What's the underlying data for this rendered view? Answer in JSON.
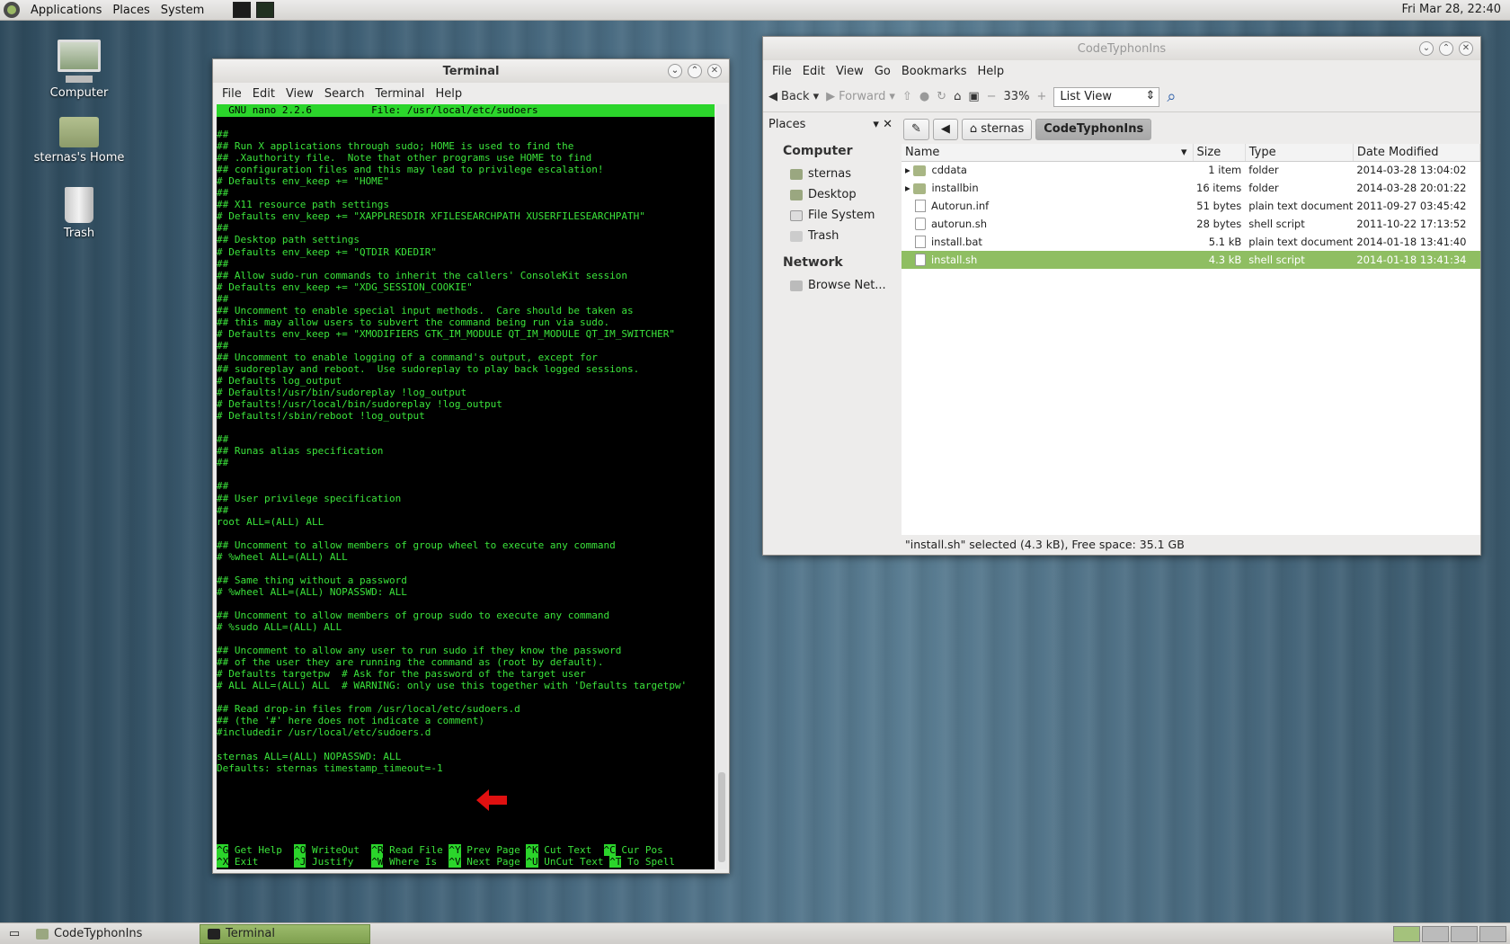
{
  "topbar": {
    "menus": [
      "Applications",
      "Places",
      "System"
    ],
    "clock": "Fri Mar 28, 22:40"
  },
  "desktop": {
    "icons": [
      {
        "label": "Computer",
        "icon": "computer-icon"
      },
      {
        "label": "sternas's Home",
        "icon": "home-folder-icon"
      },
      {
        "label": "Trash",
        "icon": "trash-icon"
      }
    ]
  },
  "terminal": {
    "title": "Terminal",
    "menus": [
      "File",
      "Edit",
      "View",
      "Search",
      "Terminal",
      "Help"
    ],
    "nano_header": "  GNU nano 2.2.6          File: /usr/local/etc/sudoers                           ",
    "lines": [
      "",
      "##",
      "## Run X applications through sudo; HOME is used to find the",
      "## .Xauthority file.  Note that other programs use HOME to find",
      "## configuration files and this may lead to privilege escalation!",
      "# Defaults env_keep += \"HOME\"",
      "##",
      "## X11 resource path settings",
      "# Defaults env_keep += \"XAPPLRESDIR XFILESEARCHPATH XUSERFILESEARCHPATH\"",
      "##",
      "## Desktop path settings",
      "# Defaults env_keep += \"QTDIR KDEDIR\"",
      "##",
      "## Allow sudo-run commands to inherit the callers' ConsoleKit session",
      "# Defaults env_keep += \"XDG_SESSION_COOKIE\"",
      "##",
      "## Uncomment to enable special input methods.  Care should be taken as",
      "## this may allow users to subvert the command being run via sudo.",
      "# Defaults env_keep += \"XMODIFIERS GTK_IM_MODULE QT_IM_MODULE QT_IM_SWITCHER\"",
      "##",
      "## Uncomment to enable logging of a command's output, except for",
      "## sudoreplay and reboot.  Use sudoreplay to play back logged sessions.",
      "# Defaults log_output",
      "# Defaults!/usr/bin/sudoreplay !log_output",
      "# Defaults!/usr/local/bin/sudoreplay !log_output",
      "# Defaults!/sbin/reboot !log_output",
      "",
      "##",
      "## Runas alias specification",
      "##",
      "",
      "##",
      "## User privilege specification",
      "##",
      "root ALL=(ALL) ALL",
      "",
      "## Uncomment to allow members of group wheel to execute any command",
      "# %wheel ALL=(ALL) ALL",
      "",
      "## Same thing without a password",
      "# %wheel ALL=(ALL) NOPASSWD: ALL",
      "",
      "## Uncomment to allow members of group sudo to execute any command",
      "# %sudo ALL=(ALL) ALL",
      "",
      "## Uncomment to allow any user to run sudo if they know the password",
      "## of the user they are running the command as (root by default).",
      "# Defaults targetpw  # Ask for the password of the target user",
      "# ALL ALL=(ALL) ALL  # WARNING: only use this together with 'Defaults targetpw'",
      "",
      "## Read drop-in files from /usr/local/etc/sudoers.d",
      "## (the '#' here does not indicate a comment)",
      "#includedir /usr/local/etc/sudoers.d",
      "",
      "sternas ALL=(ALL) NOPASSWD: ALL",
      "Defaults: sternas timestamp_timeout=-1"
    ],
    "shortcuts_row1": [
      [
        "^G",
        "Get Help "
      ],
      [
        "^O",
        "WriteOut "
      ],
      [
        "^R",
        "Read File"
      ],
      [
        "^Y",
        "Prev Page"
      ],
      [
        "^K",
        "Cut Text "
      ],
      [
        "^C",
        "Cur Pos"
      ]
    ],
    "shortcuts_row2": [
      [
        "^X",
        "Exit     "
      ],
      [
        "^J",
        "Justify  "
      ],
      [
        "^W",
        "Where Is "
      ],
      [
        "^V",
        "Next Page"
      ],
      [
        "^U",
        "UnCut Text"
      ],
      [
        "^T",
        "To Spell"
      ]
    ]
  },
  "filemanager": {
    "title": "CodeTyphonIns",
    "menus": [
      "File",
      "Edit",
      "View",
      "Go",
      "Bookmarks",
      "Help"
    ],
    "toolbar": {
      "back": "Back",
      "forward": "Forward",
      "zoom": "33%",
      "view_mode": "List View"
    },
    "sidebar": {
      "header": "Places",
      "sections": [
        {
          "title": "Computer",
          "items": [
            "sternas",
            "Desktop",
            "File System",
            "Trash"
          ]
        },
        {
          "title": "Network",
          "items": [
            "Browse Net..."
          ]
        }
      ]
    },
    "path": [
      "sternas",
      "CodeTyphonIns"
    ],
    "columns": [
      "Name",
      "Size",
      "Type",
      "Date Modified"
    ],
    "files": [
      {
        "name": "cddata",
        "size": "1 item",
        "type": "folder",
        "date": "2014-03-28 13:04:02",
        "kind": "folder"
      },
      {
        "name": "installbin",
        "size": "16 items",
        "type": "folder",
        "date": "2014-03-28 20:01:22",
        "kind": "folder"
      },
      {
        "name": "Autorun.inf",
        "size": "51 bytes",
        "type": "plain text document",
        "date": "2011-09-27 03:45:42",
        "kind": "doc"
      },
      {
        "name": "autorun.sh",
        "size": "28 bytes",
        "type": "shell script",
        "date": "2011-10-22 17:13:52",
        "kind": "sh"
      },
      {
        "name": "install.bat",
        "size": "5.1 kB",
        "type": "plain text document",
        "date": "2014-01-18 13:41:40",
        "kind": "doc"
      },
      {
        "name": "install.sh",
        "size": "4.3 kB",
        "type": "shell script",
        "date": "2014-01-18 13:41:34",
        "kind": "sh",
        "selected": true
      }
    ],
    "status": "\"install.sh\" selected (4.3 kB), Free space: 35.1 GB"
  },
  "taskbar": {
    "tasks": [
      "CodeTyphonIns",
      "Terminal"
    ]
  }
}
